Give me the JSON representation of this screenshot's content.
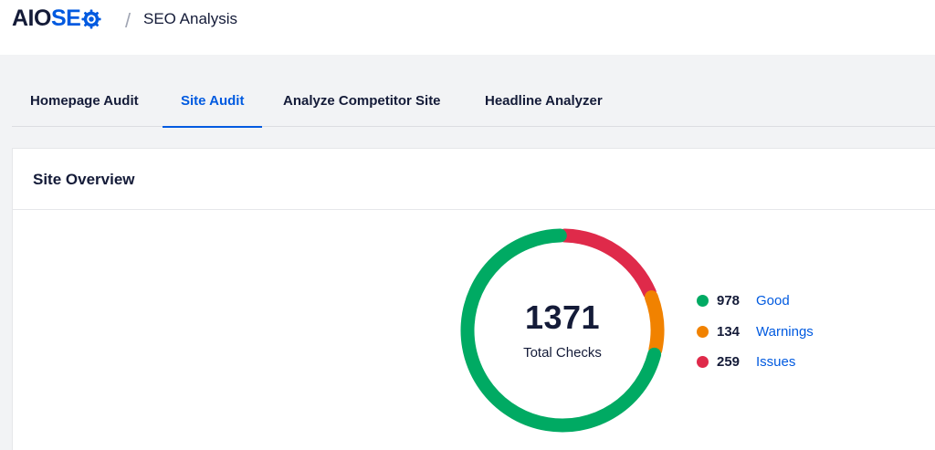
{
  "header": {
    "logo_left": "AIO",
    "logo_right": "SE",
    "logo_icon": "gear-icon",
    "separator": "/",
    "page_title": "SEO Analysis"
  },
  "tabs": [
    {
      "label": "Homepage Audit",
      "active": false
    },
    {
      "label": "Site Audit",
      "active": true
    },
    {
      "label": "Analyze Competitor Site",
      "active": false
    },
    {
      "label": "Headline Analyzer",
      "active": false
    }
  ],
  "overview": {
    "title": "Site Overview",
    "total": "1371",
    "total_label": "Total Checks",
    "items": [
      {
        "count": "978",
        "label": "Good",
        "color": "#00aa63"
      },
      {
        "count": "134",
        "label": "Warnings",
        "color": "#f18200"
      },
      {
        "count": "259",
        "label": "Issues",
        "color": "#df2a4a"
      }
    ]
  },
  "colors": {
    "brand_dark": "#141b38",
    "brand_blue": "#005ae0"
  }
}
